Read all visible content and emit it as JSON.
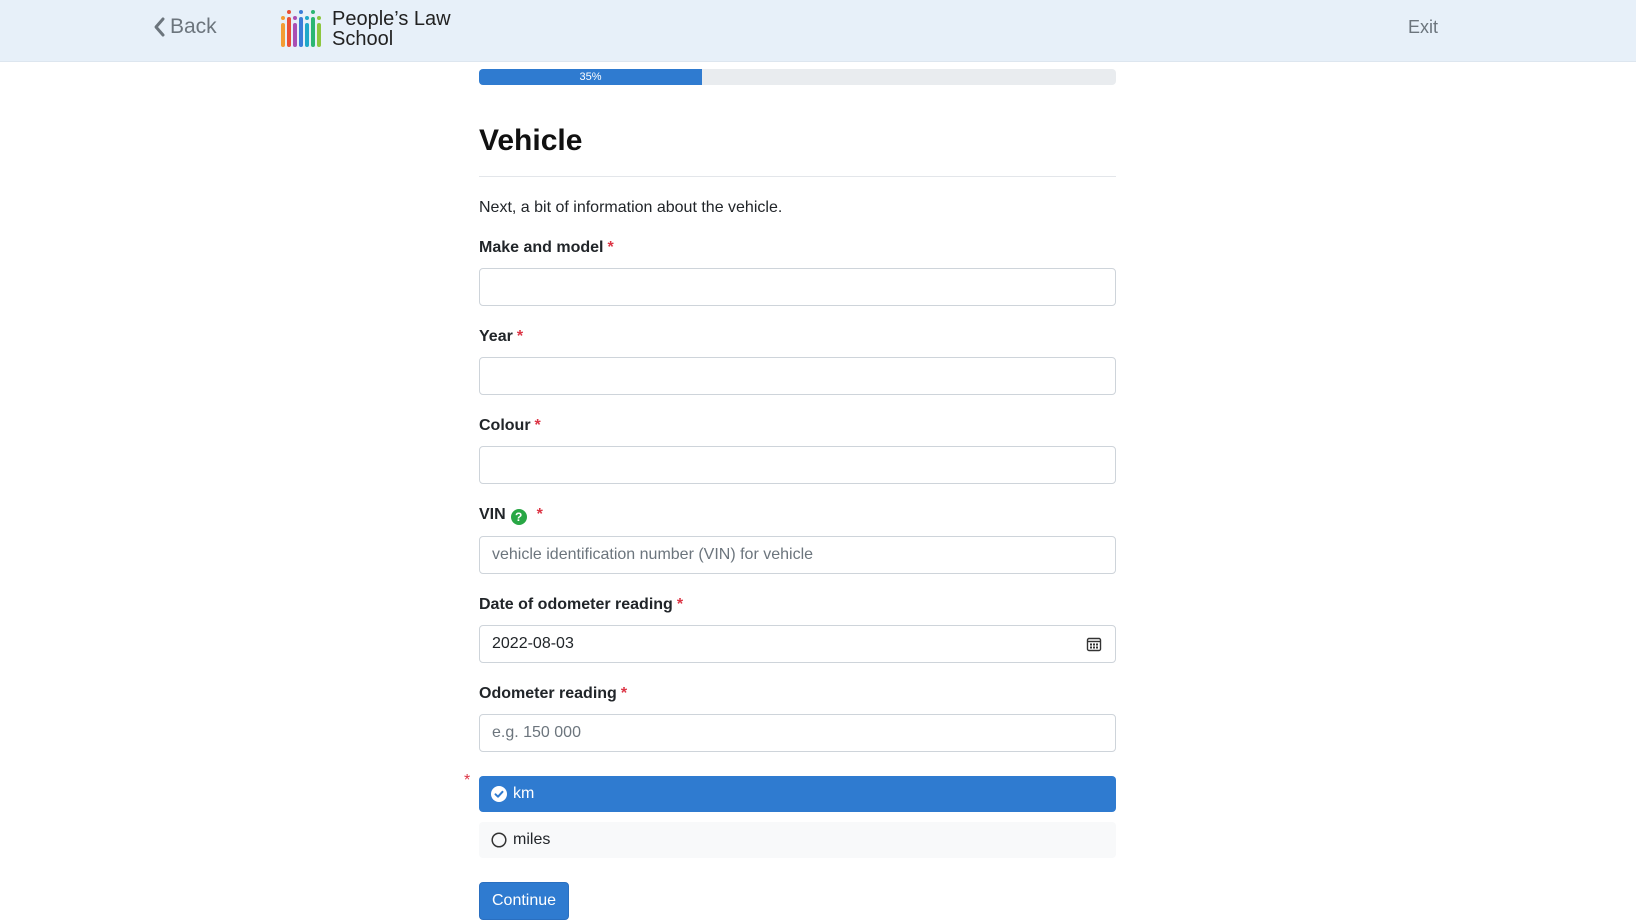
{
  "nav": {
    "back_label": "Back",
    "logo_line1": "People’s Law",
    "logo_line2": "School",
    "exit_label": "Exit"
  },
  "progress": {
    "value": 35,
    "label": "35%"
  },
  "page": {
    "title": "Vehicle",
    "intro": "Next, a bit of information about the vehicle."
  },
  "fields": {
    "make_model": {
      "label": "Make and model",
      "required": "*",
      "value": "",
      "placeholder": ""
    },
    "year": {
      "label": "Year",
      "required": "*",
      "value": "",
      "placeholder": ""
    },
    "colour": {
      "label": "Colour",
      "required": "*",
      "value": "",
      "placeholder": ""
    },
    "vin": {
      "label": "VIN",
      "required": "*",
      "value": "",
      "placeholder": "vehicle identification number (VIN) for vehicle",
      "help_icon": "question-circle-icon"
    },
    "odometer_date": {
      "label": "Date of odometer reading",
      "required": "*",
      "value": "2022-08-03",
      "icon": "calendar-icon"
    },
    "odometer": {
      "label": "Odometer reading",
      "required": "*",
      "value": "",
      "placeholder": "e.g. 150 000"
    }
  },
  "units": {
    "required": "*",
    "options": [
      {
        "label": "km",
        "selected": true
      },
      {
        "label": "miles",
        "selected": false
      }
    ]
  },
  "actions": {
    "continue_label": "Continue"
  },
  "colors": {
    "navbar_bg": "#e7f0f9",
    "primary": "#2f7bd0",
    "required": "#dc3545",
    "help": "#28a745"
  }
}
